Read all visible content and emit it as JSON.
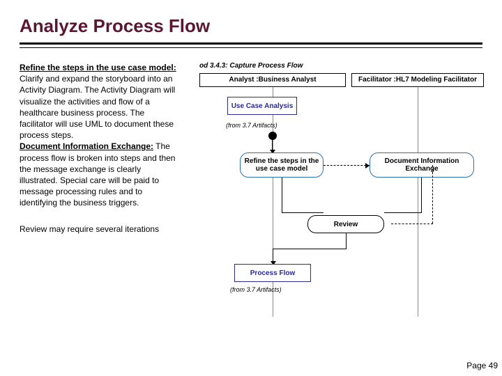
{
  "title": "Analyze Process Flow",
  "left": {
    "p1_label": "Refine the steps in the use case model:",
    "p1_body": " Clarify and expand the storyboard into an Activity Diagram. The Activity Diagram will visualize the activities and flow of a healthcare business process. The facilitator will use UML to document these process steps.",
    "p2_label": "Document Information Exchange:",
    "p2_body": " The process flow is broken into steps and then the message exchange is clearly illustrated. Special care will be paid to message processing rules and to identifying the business triggers."
  },
  "footnote": "Review may require several iterations",
  "diagram": {
    "caption": "od 3.4.3: Capture Process Flow",
    "lane_a": "Analyst :Business Analyst",
    "lane_b": "Facilitator :HL7 Modeling Facilitator",
    "use_case_analysis": "Use Case Analysis",
    "artifacts1": "(from 3.7 Artifacts)",
    "refine": "Refine the steps in the use case model",
    "docx": "Document Information Exchange",
    "review": "Review",
    "process_flow": "Process Flow",
    "artifacts2": "(from 3.7 Artifacts)"
  },
  "pagenum": "Page 49"
}
